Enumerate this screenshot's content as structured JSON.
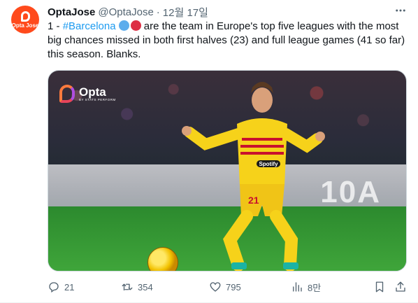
{
  "tweet": {
    "author_name": "OptaJose",
    "author_handle": "@OptaJose",
    "separator": "·",
    "date": "12월 17일",
    "text_prefix": "1 - ",
    "hashtag": "#Barcelona",
    "text_body": " are the team in Europe's top five leagues with the most big chances missed in both first halves (23) and full league games (41 so far) this season. Blanks."
  },
  "avatar": {
    "label": "Opta Jose",
    "word": "Opta Jose",
    "color": "#ff4a1c"
  },
  "media": {
    "logo_title": "Opta",
    "logo_subtitle": "BY STATS PERFORM",
    "shirt_sponsor": "Spotify",
    "shirt_number": "21",
    "board_text": "10A"
  },
  "actions": {
    "replies": "21",
    "reposts": "354",
    "likes": "795",
    "views": "8만"
  },
  "colors": {
    "text": "#0f1419",
    "secondary": "#536471",
    "link": "#1d9bf0",
    "barca_blue": "#5dadec",
    "barca_red": "#dd2e44"
  }
}
